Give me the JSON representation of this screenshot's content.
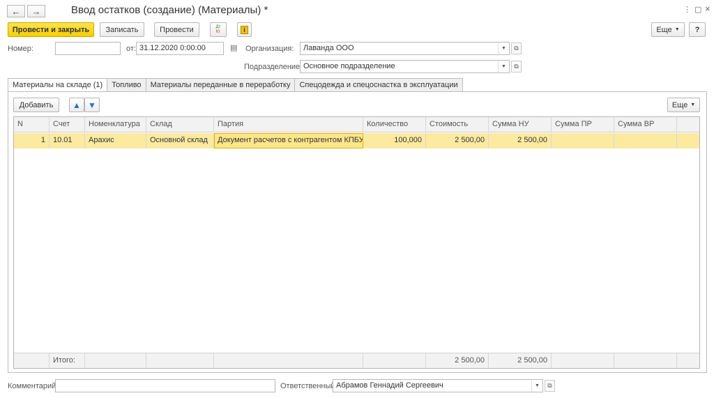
{
  "header": {
    "title": "Ввод остатков (создание) (Материалы) *",
    "back_icon": "←",
    "forward_icon": "→",
    "menu_icon": "⋮",
    "restore_icon": "▢",
    "close_icon": "×"
  },
  "toolbar": {
    "post_close": "Провести и закрыть",
    "save": "Записать",
    "post": "Провести",
    "dt_label": "Дт",
    "kt_label": "Кт",
    "info_icon": "i",
    "more": "Еще",
    "help": "?"
  },
  "form": {
    "number_label": "Номер:",
    "number_value": "",
    "date_label": "от:",
    "date_value": "31.12.2020  0:00:00",
    "org_label": "Организация:",
    "org_value": "Лаванда ООО",
    "division_label": "Подразделение:",
    "division_value": "Основное подразделение"
  },
  "tabs": [
    {
      "label": "Материалы на складе (1)"
    },
    {
      "label": "Топливо"
    },
    {
      "label": "Материалы переданные в переработку"
    },
    {
      "label": "Спецодежда и спецоснастка в эксплуатации"
    }
  ],
  "table_toolbar": {
    "add": "Добавить",
    "more": "Еще"
  },
  "table": {
    "columns": [
      "N",
      "Счет",
      "Номенклатура",
      "Склад",
      "Партия",
      "Количество",
      "Стоимость",
      "Сумма НУ",
      "Сумма ПР",
      "Сумма ВР"
    ],
    "rows": [
      {
        "n": "1",
        "account": "10.01",
        "item": "Арахис",
        "warehouse": "Основной склад",
        "batch": "Документ расчетов с контрагентом КПБУ...",
        "qty": "100,000",
        "cost": "2 500,00",
        "sum_nu": "2 500,00",
        "sum_pr": "",
        "sum_vr": ""
      }
    ],
    "totals": {
      "label": "Итого:",
      "cost": "2 500,00",
      "sum_nu": "2 500,00"
    }
  },
  "footer": {
    "comment_label": "Комментарий:",
    "comment_value": "",
    "responsible_label": "Ответственный:",
    "responsible_value": "Абрамов Геннадий Сергеевич"
  }
}
